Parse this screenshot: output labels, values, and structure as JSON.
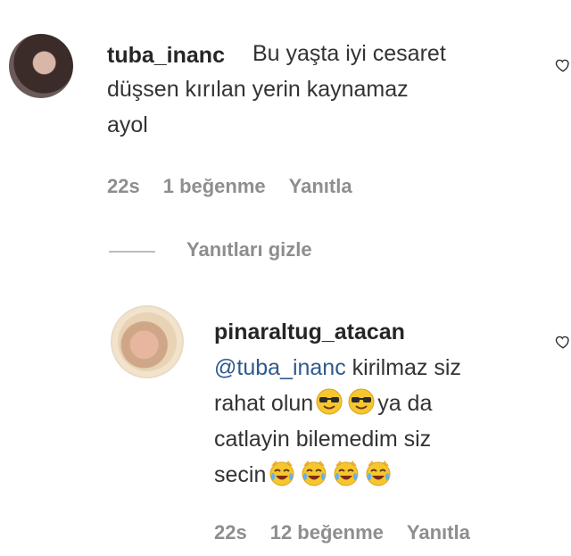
{
  "comment": {
    "username": "tuba_inanc",
    "line1": "Bu yaşta iyi cesaret",
    "line2": "düşsen kırılan yerin kaynamaz",
    "line3": "ayol",
    "time": "22s",
    "likes": "1 beğenme",
    "reply": "Yanıtla"
  },
  "replies_toggle": "Yanıtları gizle",
  "reply": {
    "username": "pinaraltug_atacan",
    "mention": "@tuba_inanc",
    "line1_rest": " kirilmaz siz",
    "line2a": "rahat olun",
    "line2b": "ya da",
    "line3": "catlayin bilemedim siz",
    "line4": "secin",
    "time": "22s",
    "likes": "12 beğenme",
    "reply": "Yanıtla"
  },
  "icons": {
    "heart": "heart-outline-icon",
    "emoji_cool": "smiling-face-with-sunglasses",
    "emoji_cat": "cat-face-with-tears-of-joy"
  },
  "colors": {
    "meta": "#8e8e8e",
    "mention": "#2e5a8c"
  }
}
